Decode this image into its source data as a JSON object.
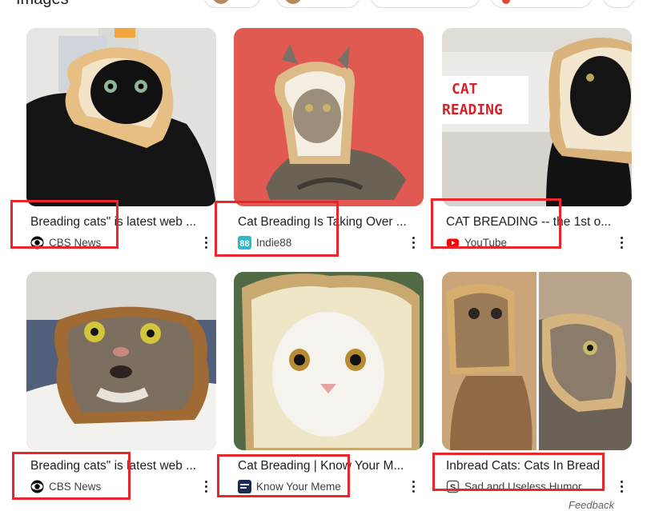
{
  "top": {
    "title": "Images",
    "chips": [
      "chip-1",
      "chip-2",
      "chip-3",
      "chip-4",
      "chip-5"
    ]
  },
  "results": [
    {
      "caption": "Breading cats\" is latest web ...",
      "source": "CBS News",
      "favicon": "cbs-eye-icon",
      "image": "black cat with bread slice face"
    },
    {
      "caption": "Cat Breading Is Taking Over ...",
      "source": "Indie88",
      "favicon": "indie88-logo-icon",
      "image": "tabby cat with bread slice on red background"
    },
    {
      "caption": "CAT BREADING -- the 1st o...",
      "source": "YouTube",
      "favicon": "youtube-play-icon",
      "image": "black cat in bread with CAT BREADING text",
      "overlay_text": "CAT\nREADING"
    },
    {
      "caption": "Breading cats\" is latest web ...",
      "source": "CBS News",
      "favicon": "cbs-eye-icon",
      "image": "surprised tabby cat in bread"
    },
    {
      "caption": "Cat Breading | Know Your M...",
      "source": "Know Your Meme",
      "favicon": "kym-logo-icon",
      "image": "white cat face in bread slice"
    },
    {
      "caption": "Inbread Cats: Cats In Bread",
      "source": "Sad and Useless Humor",
      "favicon": "s-logo-icon",
      "image": "two tabby cats in bread"
    }
  ],
  "footer": {
    "feedback": "Feedback"
  },
  "colors": {
    "highlight": "#e8262b",
    "text": "#202124",
    "secondary": "#3c4043",
    "youtube": "#ff0000",
    "indie88": "#2fb8c8",
    "kym": "#1a2b55"
  }
}
